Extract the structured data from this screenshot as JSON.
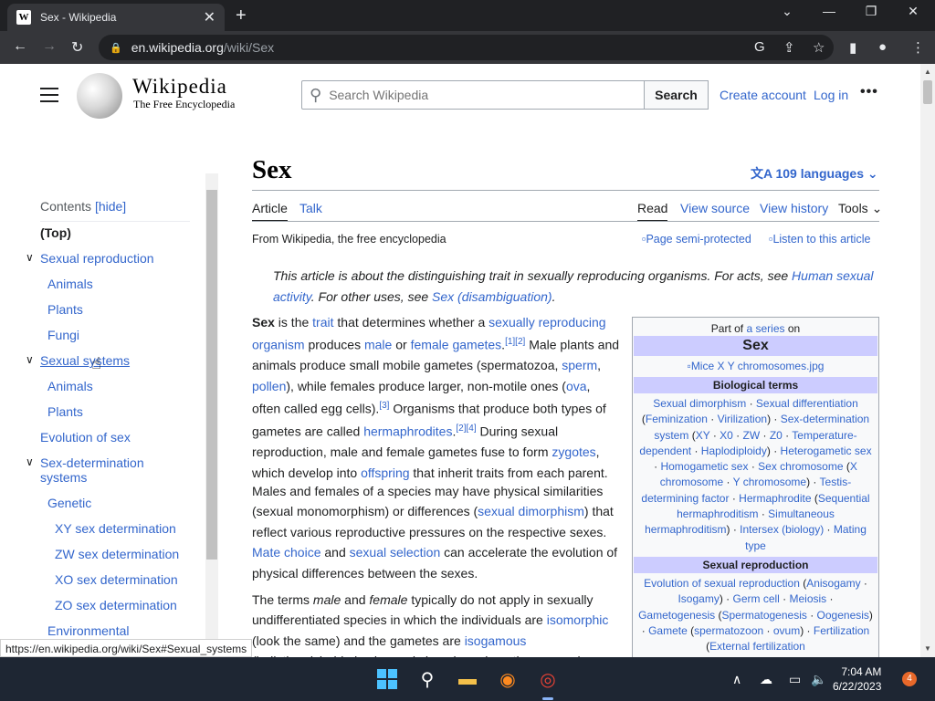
{
  "browser": {
    "tab_title": "Sex - Wikipedia",
    "favicon_letter": "W",
    "url_host": "en.wikipedia.org",
    "url_path": "/wiki/Sex"
  },
  "header": {
    "wordmark": "Wikipedia",
    "tagline": "The Free Encyclopedia",
    "search_placeholder": "Search Wikipedia",
    "search_button": "Search",
    "create_account": "Create account",
    "log_in": "Log in",
    "more": "•••"
  },
  "toc": {
    "title": "Contents",
    "hide": "[hide]",
    "items": [
      {
        "label": "(Top)"
      },
      {
        "label": "Sexual reproduction"
      },
      {
        "label": "Animals"
      },
      {
        "label": "Plants"
      },
      {
        "label": "Fungi"
      },
      {
        "label": "Sexual systems"
      },
      {
        "label": "Animals"
      },
      {
        "label": "Plants"
      },
      {
        "label": "Evolution of sex"
      },
      {
        "label": "Sex-determination systems"
      },
      {
        "label": "Genetic"
      },
      {
        "label": "XY sex determination"
      },
      {
        "label": "ZW sex determination"
      },
      {
        "label": "XO sex determination"
      },
      {
        "label": "ZO sex determination"
      },
      {
        "label": "Environmental"
      }
    ]
  },
  "article": {
    "title": "Sex",
    "languages": "109 languages",
    "tabs": {
      "article": "Article",
      "talk": "Talk",
      "read": "Read",
      "view_source": "View source",
      "view_history": "View history",
      "tools": "Tools"
    },
    "from": "From Wikipedia, the free encyclopedia",
    "semi_protected": "Page semi-protected",
    "listen": "Listen to this article",
    "hatnote": {
      "t1": "This article is about the distinguishing trait in sexually reproducing organisms. For acts, see ",
      "l1": "Human sexual activity",
      "t2": ". For other uses, see ",
      "l2": "Sex (disambiguation)",
      "t3": "."
    }
  },
  "infobox": {
    "part_of": "Part of",
    "series_link": "a series",
    "on": "on",
    "title": "Sex",
    "image": "Mice X Y chromosomes.jpg",
    "bio_head": "Biological terms",
    "repro_head": "Sexual reproduction"
  },
  "status_url": "https://en.wikipedia.org/wiki/Sex#Sexual_systems",
  "taskbar": {
    "time": "7:04 AM",
    "date": "6/22/2023",
    "notifications": "4"
  }
}
